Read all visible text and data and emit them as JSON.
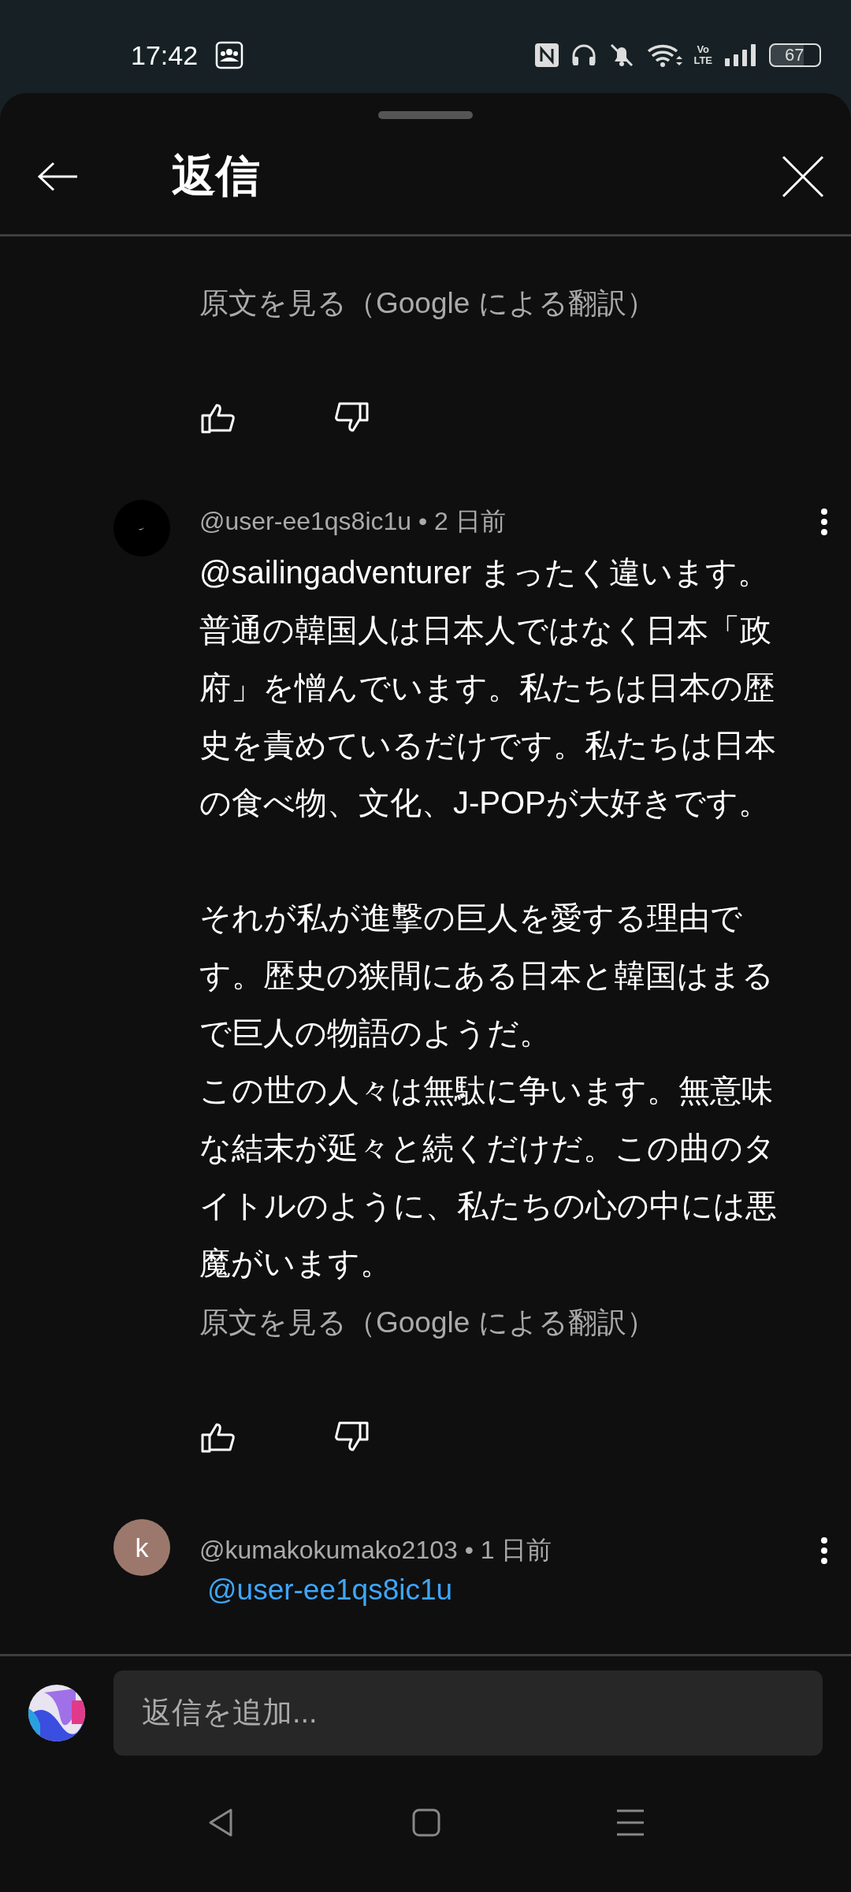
{
  "status_bar": {
    "time": "17:42",
    "network_label": "Vo\nLTE",
    "battery": "67"
  },
  "header": {
    "title": "返信"
  },
  "comments": [
    {
      "kind": "tail",
      "translate_link": "原文を見る（Google による翻訳）"
    },
    {
      "kind": "full",
      "avatar": {
        "kind": "dark"
      },
      "meta": "@user-ee1qs8ic1u • 2 日前",
      "paragraphs": [
        {
          "kind": "paragraph",
          "text": "@sailingadventurer まったく違います。普通の韓国人は日本人ではなく日本「政府」を憎んでいます。私たちは日本の歴史を責めているだけです。私たちは日本の食べ物、文化、J-POPが大好きです。"
        },
        {
          "kind": "paragraph",
          "text": "それが私が進撃の巨人を愛する理由です。歴史の狭間にある日本と韓国はまるで巨人の物語のようだ。"
        },
        {
          "kind": "line",
          "text": "この世の人々は無駄に争います。無意味な結末が延々と続くだけだ。この曲のタイトルのように、私たちの心の中には悪魔がいます。"
        }
      ],
      "translate_link": "原文を見る（Google による翻訳）"
    },
    {
      "kind": "head",
      "avatar": {
        "kind": "letter",
        "letter": "k",
        "color": "#9c786c"
      },
      "meta": "@kumakokumako2103 • 1 日前",
      "mention": "@user-ee1qs8ic1u"
    }
  ],
  "reply_box": {
    "placeholder": "返信を追加..."
  }
}
